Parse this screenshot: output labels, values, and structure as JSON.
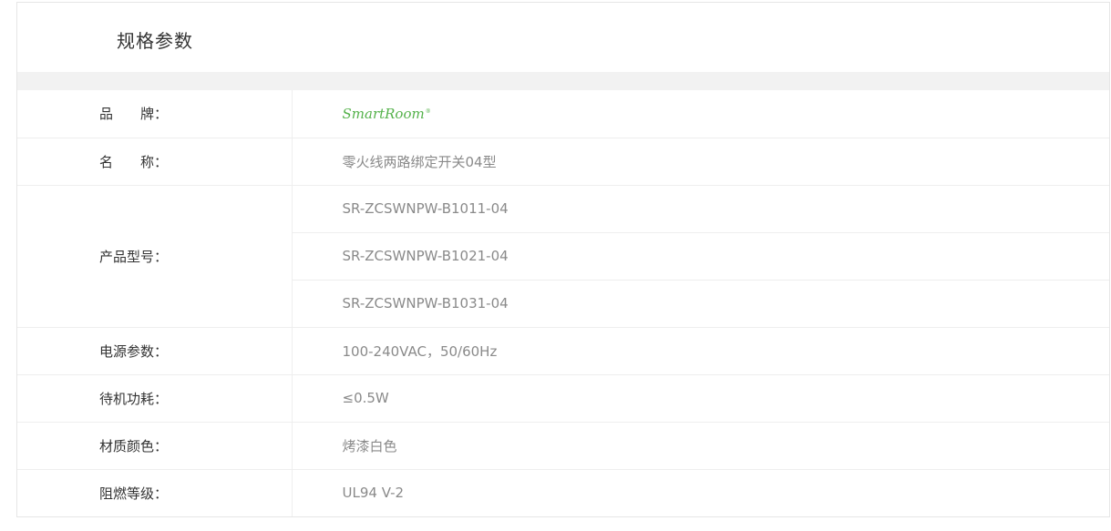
{
  "section": {
    "title": "规格参数"
  },
  "specs": {
    "brand": {
      "label": "品　　牌：",
      "logo_text": "SmartRoom",
      "logo_mark": "®",
      "logo_color": "#55b24b"
    },
    "name": {
      "label": "名　　称：",
      "value": "零火线两路绑定开关04型"
    },
    "model": {
      "label": "产品型号：",
      "values": [
        "SR-ZCSWNPW-B1011-04",
        "SR-ZCSWNPW-B1021-04",
        "SR-ZCSWNPW-B1031-04"
      ]
    },
    "power": {
      "label": "电源参数：",
      "value": "100-240VAC，50/60Hz"
    },
    "standby": {
      "label": "待机功耗：",
      "value": "≤0.5W"
    },
    "material": {
      "label": "材质颜色：",
      "value": "烤漆白色"
    },
    "flame": {
      "label": "阻燃等级：",
      "value": "UL94 V-2"
    }
  }
}
